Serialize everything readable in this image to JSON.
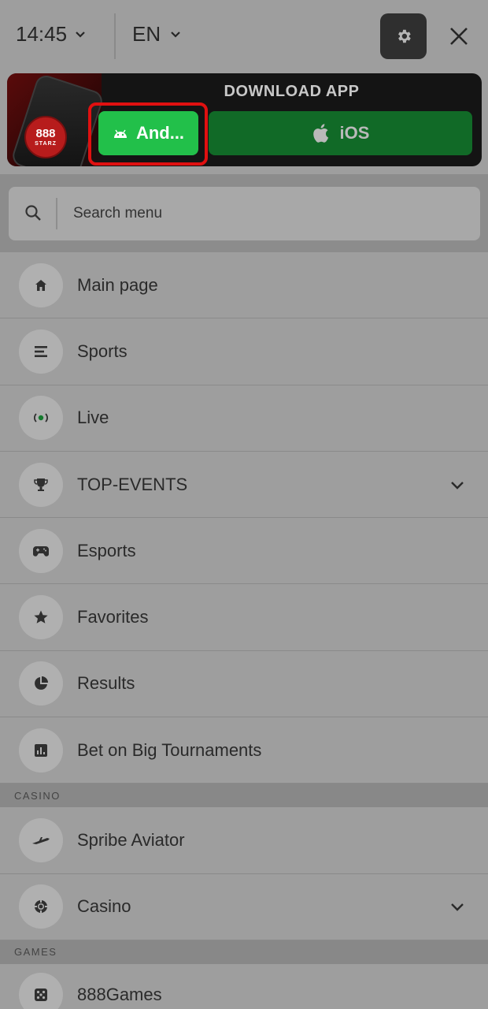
{
  "topbar": {
    "time": "14:45",
    "language": "EN",
    "icons": {
      "settings": "gear-icon",
      "close": "close-icon"
    }
  },
  "banner": {
    "title": "DOWNLOAD APP",
    "logo_text": "888",
    "logo_sub": "STARZ",
    "android_label": "And...",
    "ios_label": "iOS",
    "colors": {
      "android": "#22c04a",
      "ios": "#116a27",
      "highlight": "#e01010"
    }
  },
  "search": {
    "placeholder": "Search menu"
  },
  "menu": {
    "items": [
      {
        "label": "Main page",
        "icon": "home-icon"
      },
      {
        "label": "Sports",
        "icon": "list-icon"
      },
      {
        "label": "Live",
        "icon": "live-icon"
      },
      {
        "label": "TOP-EVENTS",
        "icon": "trophy-icon",
        "expandable": true
      },
      {
        "label": "Esports",
        "icon": "gamepad-icon"
      },
      {
        "label": "Favorites",
        "icon": "star-icon"
      },
      {
        "label": "Results",
        "icon": "pie-chart-icon"
      },
      {
        "label": "Bet on Big Tournaments",
        "icon": "bar-chart-icon"
      }
    ],
    "casino_header": "CASINO",
    "casino_items": [
      {
        "label": "Spribe Aviator",
        "icon": "plane-icon"
      },
      {
        "label": "Casino",
        "icon": "chip-icon",
        "expandable": true
      }
    ],
    "games_header": "GAMES",
    "games_items": [
      {
        "label": "888Games",
        "icon": "dice-icon"
      }
    ]
  }
}
